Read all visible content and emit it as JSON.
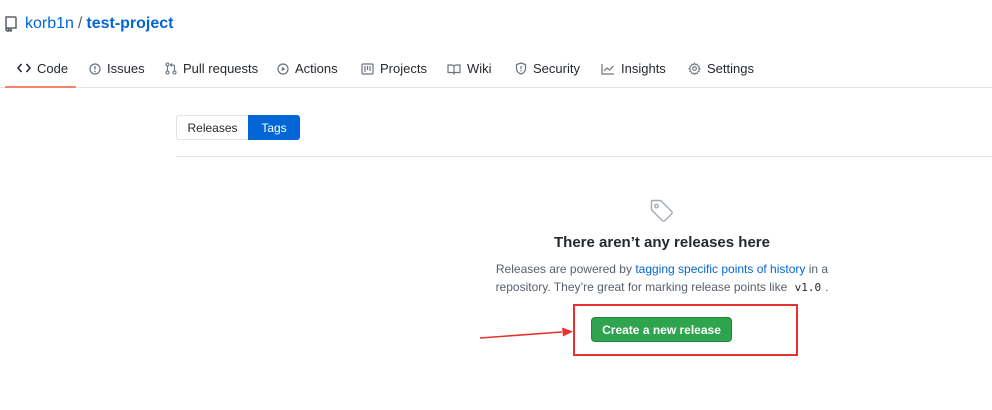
{
  "repo": {
    "owner": "korb1n",
    "separator": "/",
    "name": "test-project"
  },
  "nav": {
    "items": [
      {
        "label": "Code",
        "icon": "code-icon",
        "active": true
      },
      {
        "label": "Issues",
        "icon": "issue-icon"
      },
      {
        "label": "Pull requests",
        "icon": "pull-request-icon"
      },
      {
        "label": "Actions",
        "icon": "play-icon"
      },
      {
        "label": "Projects",
        "icon": "project-icon"
      },
      {
        "label": "Wiki",
        "icon": "book-icon"
      },
      {
        "label": "Security",
        "icon": "shield-icon"
      },
      {
        "label": "Insights",
        "icon": "graph-icon"
      },
      {
        "label": "Settings",
        "icon": "gear-icon"
      }
    ]
  },
  "subnav": {
    "releases": "Releases",
    "tags": "Tags",
    "selected": "Tags"
  },
  "blankslate": {
    "icon": "tag-icon",
    "title": "There aren’t any releases here",
    "desc_prefix": "Releases are powered by",
    "desc_link": "tagging specific points of history",
    "desc_middle": "in a repository. They’re great for marking release points like",
    "desc_code": "v1.0",
    "desc_suffix": ".",
    "button": "Create a new release"
  },
  "colors": {
    "link": "#0366d6",
    "active_tab_underline": "#f9826c",
    "primary_button": "#2ea44f",
    "annotation": "#e5322e"
  }
}
